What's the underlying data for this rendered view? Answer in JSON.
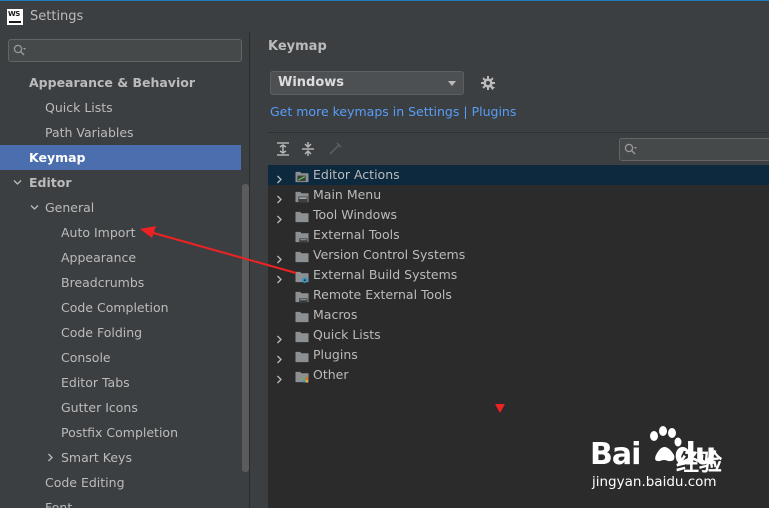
{
  "window": {
    "title": "Settings",
    "app_icon_text": "WS"
  },
  "sidebar": {
    "search_placeholder": "",
    "items": [
      {
        "label": "Appearance & Behavior",
        "level": 1,
        "bold": true,
        "expandable": false
      },
      {
        "label": "Quick Lists",
        "level": 2
      },
      {
        "label": "Path Variables",
        "level": 2
      },
      {
        "label": "Keymap",
        "level": 1,
        "bold": true,
        "selected": true
      },
      {
        "label": "Editor",
        "level": 1,
        "bold": true,
        "expandable": true,
        "expanded": true
      },
      {
        "label": "General",
        "level": 2,
        "expandable": true,
        "expanded": true
      },
      {
        "label": "Auto Import",
        "level": 3
      },
      {
        "label": "Appearance",
        "level": 3
      },
      {
        "label": "Breadcrumbs",
        "level": 3
      },
      {
        "label": "Code Completion",
        "level": 3
      },
      {
        "label": "Code Folding",
        "level": 3
      },
      {
        "label": "Console",
        "level": 3
      },
      {
        "label": "Editor Tabs",
        "level": 3
      },
      {
        "label": "Gutter Icons",
        "level": 3
      },
      {
        "label": "Postfix Completion",
        "level": 3
      },
      {
        "label": "Smart Keys",
        "level": 3,
        "expandable": true,
        "expanded": false
      },
      {
        "label": "Code Editing",
        "level": 2
      },
      {
        "label": "Font",
        "level": 2
      }
    ]
  },
  "main": {
    "title": "Keymap",
    "keymap_select": {
      "value": "Windows"
    },
    "settings_icon": "gear-icon",
    "link": {
      "text": "Get more keymaps in Settings",
      "separator": "|",
      "text2": "Plugins"
    },
    "toolbar": [
      "expand-all-icon",
      "collapse-all-icon",
      "edit-shortcut-icon"
    ],
    "filter_placeholder": "",
    "tree": [
      {
        "label": "Editor Actions",
        "expandable": true,
        "selected": true,
        "icon": "editor-actions-folder-icon"
      },
      {
        "label": "Main Menu",
        "expandable": true,
        "icon": "main-menu-folder-icon"
      },
      {
        "label": "Tool Windows",
        "expandable": true,
        "icon": "folder-icon"
      },
      {
        "label": "External Tools",
        "expandable": false,
        "icon": "external-tools-folder-icon"
      },
      {
        "label": "Version Control Systems",
        "expandable": true,
        "icon": "folder-icon"
      },
      {
        "label": "External Build Systems",
        "expandable": true,
        "icon": "build-systems-folder-icon"
      },
      {
        "label": "Remote External Tools",
        "expandable": false,
        "icon": "remote-tools-folder-icon"
      },
      {
        "label": "Macros",
        "expandable": false,
        "icon": "folder-icon"
      },
      {
        "label": "Quick Lists",
        "expandable": true,
        "icon": "folder-icon"
      },
      {
        "label": "Plugins",
        "expandable": true,
        "icon": "folder-icon"
      },
      {
        "label": "Other",
        "expandable": true,
        "icon": "other-folder-icon"
      }
    ]
  },
  "watermark": {
    "brand": "Bai",
    "brand2": "du",
    "cn": "经验",
    "url": "jingyan.baidu.com"
  },
  "colors": {
    "selection": "#4b6eaf",
    "tree_selection": "#0d293e",
    "link": "#589df6",
    "annotation": "#ee2222"
  }
}
